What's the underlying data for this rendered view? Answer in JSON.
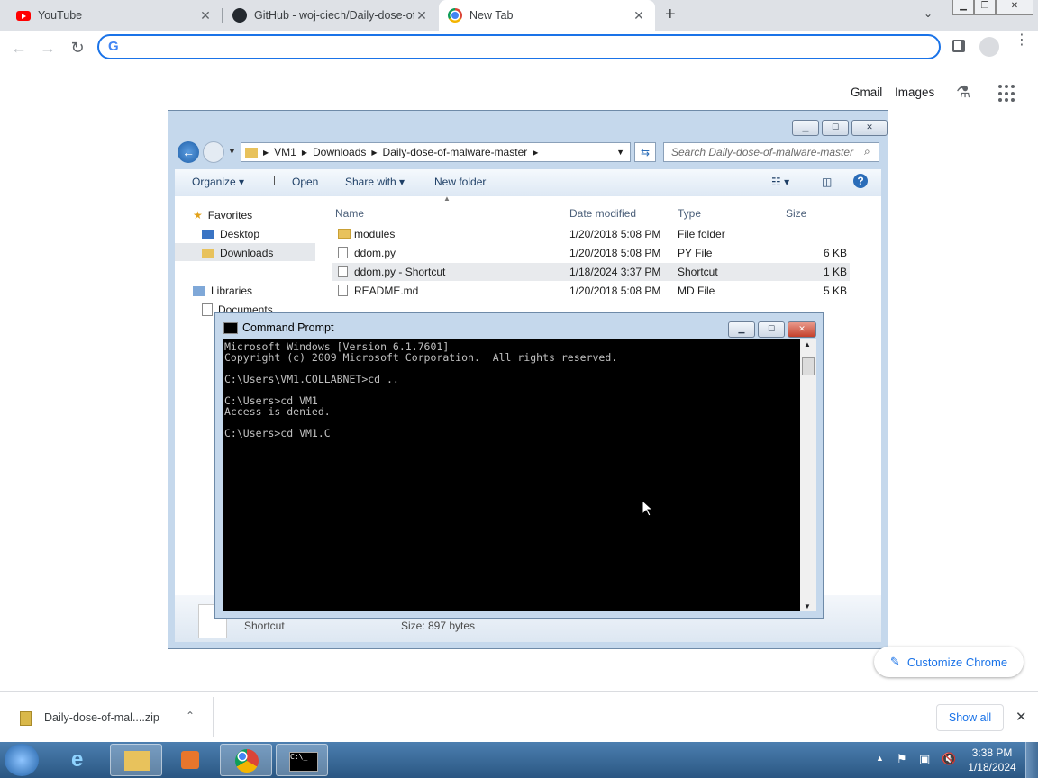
{
  "tabs": [
    {
      "title": "YouTube",
      "icon": "youtube-icon"
    },
    {
      "title": "GitHub - woj-ciech/Daily-dose-of-",
      "icon": "github-icon"
    },
    {
      "title": "New Tab",
      "icon": "chrome-icon",
      "active": true
    }
  ],
  "ntp": {
    "gmail": "Gmail",
    "images": "Images"
  },
  "explorer": {
    "breadcrumb": [
      "VM1",
      "Downloads",
      "Daily-dose-of-malware-master"
    ],
    "search_placeholder": "Search Daily-dose-of-malware-master",
    "commands": {
      "organize": "Organize",
      "open": "Open",
      "share": "Share with",
      "newfolder": "New folder"
    },
    "nav": {
      "favorites": "Favorites",
      "desktop": "Desktop",
      "downloads": "Downloads",
      "libraries": "Libraries",
      "documents": "Documents"
    },
    "columns": {
      "name": "Name",
      "date": "Date modified",
      "type": "Type",
      "size": "Size"
    },
    "files": [
      {
        "name": "modules",
        "date": "1/20/2018 5:08 PM",
        "type": "File folder",
        "size": ""
      },
      {
        "name": "ddom.py",
        "date": "1/20/2018 5:08 PM",
        "type": "PY File",
        "size": "6 KB"
      },
      {
        "name": "ddom.py - Shortcut",
        "date": "1/18/2024 3:37 PM",
        "type": "Shortcut",
        "size": "1 KB"
      },
      {
        "name": "README.md",
        "date": "1/20/2018 5:08 PM",
        "type": "MD File",
        "size": "5 KB"
      }
    ],
    "details": {
      "type": "Shortcut",
      "size": "Size: 897 bytes"
    }
  },
  "cmd": {
    "title": "Command Prompt",
    "text": "Microsoft Windows [Version 6.1.7601]\nCopyright (c) 2009 Microsoft Corporation.  All rights reserved.\n\nC:\\Users\\VM1.COLLABNET>cd ..\n\nC:\\Users>cd VM1\nAccess is denied.\n\nC:\\Users>cd VM1.C"
  },
  "customize": "Customize Chrome",
  "download": {
    "file": "Daily-dose-of-mal....zip",
    "show_all": "Show all"
  },
  "clock": {
    "time": "3:38 PM",
    "date": "1/18/2024"
  }
}
